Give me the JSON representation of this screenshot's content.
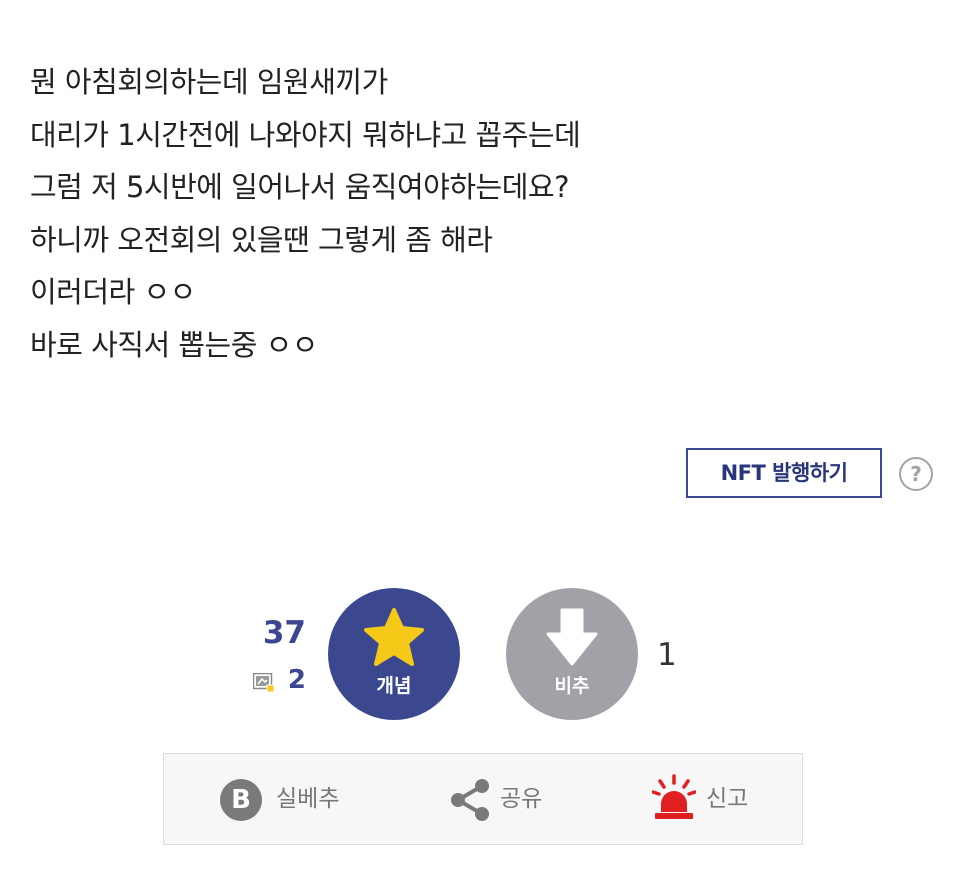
{
  "post": {
    "lines": [
      "뭔 아침회의하는데 임원새끼가",
      "대리가 1시간전에 나와야지 뭐하냐고 꼽주는데",
      "그럼 저 5시반에 일어나서 움직여야하는데요?",
      "하니까 오전회의 있을땐 그렇게 좀 해라",
      "이러더라 ㅇㅇ",
      "바로 사직서 뽑는중 ㅇㅇ"
    ]
  },
  "nft": {
    "button_label": "NFT 발행하기",
    "help_label": "?"
  },
  "vote": {
    "up_count": "37",
    "fix_count": "2",
    "up_label": "개념",
    "down_label": "비추",
    "down_count": "1",
    "up_color": "#3b4890",
    "down_color": "#a1a1a8",
    "star_color": "#f6c817"
  },
  "actions": {
    "best_icon_letter": "B",
    "best_label": "실베추",
    "share_label": "공유",
    "report_label": "신고",
    "report_color": "#e02020"
  }
}
